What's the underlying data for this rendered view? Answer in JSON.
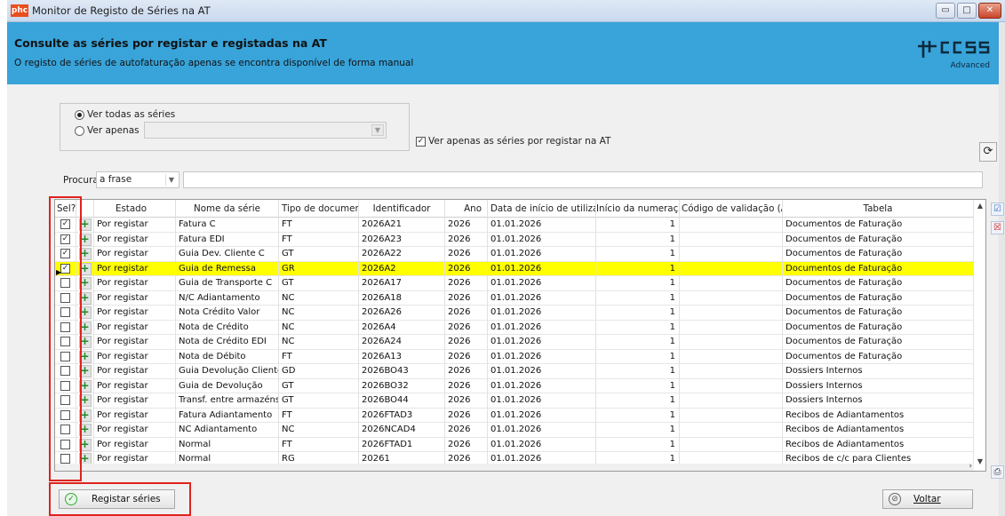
{
  "window": {
    "icon_text": "phc",
    "title": "Monitor de Registo de Séries na AT",
    "minimize": "▭",
    "maximize": "□",
    "close": "✕"
  },
  "header": {
    "title": "Consulte as séries por registar e registadas na AT",
    "subtitle": "O registo de séries de autofaturação apenas se encontra disponível de forma manual",
    "logo_sub": "Advanced"
  },
  "filters": {
    "option_all": "Ver todas as séries",
    "option_only": "Ver apenas",
    "option_only_value": "",
    "only_unregistered": "Ver apenas as séries por registar na AT",
    "only_unregistered_checked": true
  },
  "search": {
    "label": "Procura",
    "mode": "a frase",
    "value": ""
  },
  "grid": {
    "columns": [
      "Sel?",
      "",
      "Estado",
      "Nome da série",
      "Tipo de documento",
      "Identificador",
      "Ano",
      "Data de início de utilização",
      "Início da numeração",
      "Código de validação (AT)",
      "Tabela"
    ],
    "rows": [
      {
        "sel": true,
        "estado": "Por registar",
        "nome": "Fatura C",
        "tipo": "FT",
        "id": "2026A21",
        "ano": "2026",
        "data": "01.01.2026",
        "inicio": "1",
        "codigo": "",
        "tabela": "Documentos de Faturação"
      },
      {
        "sel": true,
        "estado": "Por registar",
        "nome": "Fatura EDI",
        "tipo": "FT",
        "id": "2026A23",
        "ano": "2026",
        "data": "01.01.2026",
        "inicio": "1",
        "codigo": "",
        "tabela": "Documentos de Faturação"
      },
      {
        "sel": true,
        "estado": "Por registar",
        "nome": "Guia Dev. Cliente C",
        "tipo": "GT",
        "id": "2026A22",
        "ano": "2026",
        "data": "01.01.2026",
        "inicio": "1",
        "codigo": "",
        "tabela": "Documentos de Faturação"
      },
      {
        "sel": true,
        "current": true,
        "estado": "Por registar",
        "nome": "Guia de Remessa",
        "tipo": "GR",
        "id": "2026A2",
        "ano": "2026",
        "data": "01.01.2026",
        "inicio": "1",
        "codigo": "",
        "tabela": "Documentos de Faturação"
      },
      {
        "sel": false,
        "estado": "Por registar",
        "nome": "Guia de Transporte C",
        "tipo": "GT",
        "id": "2026A17",
        "ano": "2026",
        "data": "01.01.2026",
        "inicio": "1",
        "codigo": "",
        "tabela": "Documentos de Faturação"
      },
      {
        "sel": false,
        "estado": "Por registar",
        "nome": "N/C Adiantamento",
        "tipo": "NC",
        "id": "2026A18",
        "ano": "2026",
        "data": "01.01.2026",
        "inicio": "1",
        "codigo": "",
        "tabela": "Documentos de Faturação"
      },
      {
        "sel": false,
        "estado": "Por registar",
        "nome": "Nota Crédito Valor",
        "tipo": "NC",
        "id": "2026A26",
        "ano": "2026",
        "data": "01.01.2026",
        "inicio": "1",
        "codigo": "",
        "tabela": "Documentos de Faturação"
      },
      {
        "sel": false,
        "estado": "Por registar",
        "nome": "Nota de Crédito",
        "tipo": "NC",
        "id": "2026A4",
        "ano": "2026",
        "data": "01.01.2026",
        "inicio": "1",
        "codigo": "",
        "tabela": "Documentos de Faturação"
      },
      {
        "sel": false,
        "estado": "Por registar",
        "nome": "Nota de Crédito EDI",
        "tipo": "NC",
        "id": "2026A24",
        "ano": "2026",
        "data": "01.01.2026",
        "inicio": "1",
        "codigo": "",
        "tabela": "Documentos de Faturação"
      },
      {
        "sel": false,
        "estado": "Por registar",
        "nome": "Nota de Débito",
        "tipo": "FT",
        "id": "2026A13",
        "ano": "2026",
        "data": "01.01.2026",
        "inicio": "1",
        "codigo": "",
        "tabela": "Documentos de Faturação"
      },
      {
        "sel": false,
        "estado": "Por registar",
        "nome": "Guia Devolução Cliente",
        "tipo": "GD",
        "id": "2026BO43",
        "ano": "2026",
        "data": "01.01.2026",
        "inicio": "1",
        "codigo": "",
        "tabela": "Dossiers Internos"
      },
      {
        "sel": false,
        "estado": "Por registar",
        "nome": "Guia de Devolução",
        "tipo": "GT",
        "id": "2026BO32",
        "ano": "2026",
        "data": "01.01.2026",
        "inicio": "1",
        "codigo": "",
        "tabela": "Dossiers Internos"
      },
      {
        "sel": false,
        "estado": "Por registar",
        "nome": "Transf. entre armazéns",
        "tipo": "GT",
        "id": "2026BO44",
        "ano": "2026",
        "data": "01.01.2026",
        "inicio": "1",
        "codigo": "",
        "tabela": "Dossiers Internos"
      },
      {
        "sel": false,
        "estado": "Por registar",
        "nome": "Fatura Adiantamento",
        "tipo": "FT",
        "id": "2026FTAD3",
        "ano": "2026",
        "data": "01.01.2026",
        "inicio": "1",
        "codigo": "",
        "tabela": "Recibos de Adiantamentos"
      },
      {
        "sel": false,
        "estado": "Por registar",
        "nome": "NC Adiantamento",
        "tipo": "NC",
        "id": "2026NCAD4",
        "ano": "2026",
        "data": "01.01.2026",
        "inicio": "1",
        "codigo": "",
        "tabela": "Recibos de Adiantamentos"
      },
      {
        "sel": false,
        "estado": "Por registar",
        "nome": "Normal",
        "tipo": "FT",
        "id": "2026FTAD1",
        "ano": "2026",
        "data": "01.01.2026",
        "inicio": "1",
        "codigo": "",
        "tabela": "Recibos de Adiantamentos"
      },
      {
        "sel": false,
        "estado": "Por registar",
        "nome": "Normal",
        "tipo": "RG",
        "id": "20261",
        "ano": "2026",
        "data": "01.01.2026",
        "inicio": "1",
        "codigo": "",
        "tabela": "Recibos de c/c para Clientes"
      }
    ]
  },
  "buttons": {
    "register": "Registar séries",
    "back": "Voltar"
  },
  "colors": {
    "header_bg": "#38a4da",
    "selected_row": "#ffff00",
    "highlight_box": "#e0221e",
    "add_icon": "#1e8a2a"
  },
  "icons": {
    "refresh": "refresh-icon",
    "select_all": "select-all-icon",
    "deselect_all": "deselect-all-icon",
    "print": "print-icon",
    "add_row": "add-icon",
    "register": "check-circle-icon",
    "back": "cancel-icon"
  }
}
